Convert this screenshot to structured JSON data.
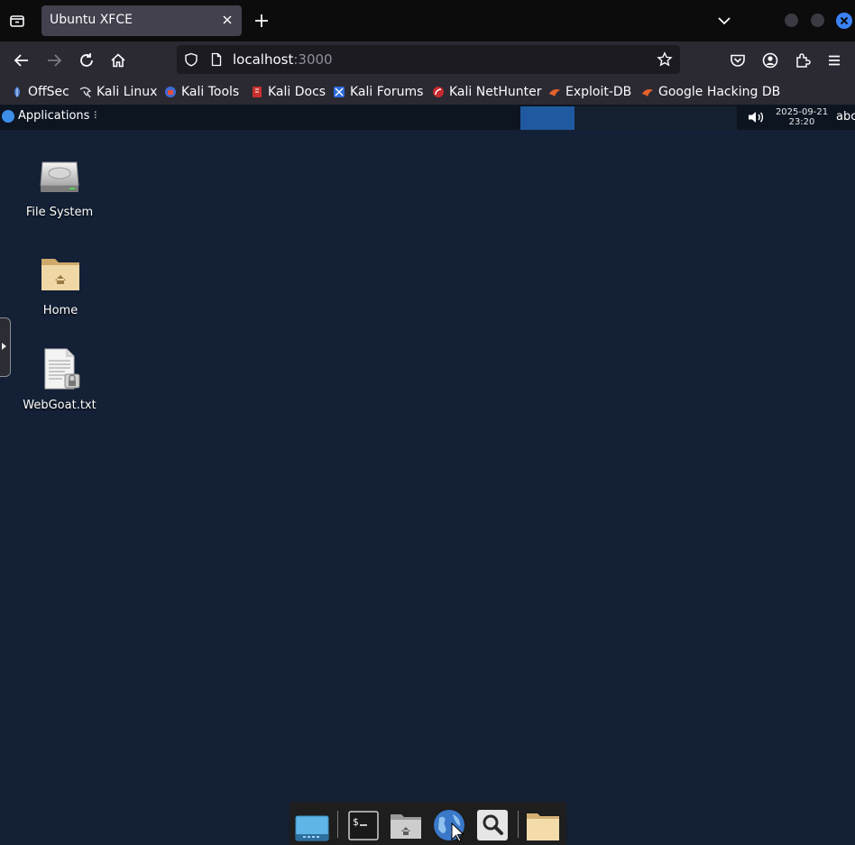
{
  "browser": {
    "tab": {
      "title": "Ubuntu XFCE"
    },
    "url": {
      "host": "localhost",
      "port": ":3000"
    },
    "bookmarks": [
      {
        "label": "OffSec",
        "icon": "offsec-icon"
      },
      {
        "label": "Kali Linux",
        "icon": "kali-dragon-icon"
      },
      {
        "label": "Kali Tools",
        "icon": "kali-tools-icon"
      },
      {
        "label": "Kali Docs",
        "icon": "kali-docs-icon"
      },
      {
        "label": "Kali Forums",
        "icon": "kali-forums-icon"
      },
      {
        "label": "Kali NetHunter",
        "icon": "nethunter-icon"
      },
      {
        "label": "Exploit-DB",
        "icon": "exploit-db-icon"
      },
      {
        "label": "Google Hacking DB",
        "icon": "ghdb-icon"
      }
    ]
  },
  "desktop": {
    "panel": {
      "applications_label": "Applications",
      "menu_glyph": "⠇",
      "clock_date": "2025-09-21",
      "clock_time": "23:20",
      "keyboard_layout": "abc"
    },
    "icons": [
      {
        "label": "File System",
        "icon": "drive-icon"
      },
      {
        "label": "Home",
        "icon": "home-folder-icon"
      },
      {
        "label": "WebGoat.txt",
        "icon": "text-file-locked-icon"
      }
    ],
    "dock": [
      "show-desktop-icon",
      "terminal-icon",
      "home-folder-icon",
      "web-browser-icon",
      "search-icon",
      "folder-icon"
    ]
  },
  "colors": {
    "desktop_bg": "#132035",
    "panel_bg": "#0d1521",
    "active_workspace": "#1f5aa0",
    "browser_toolbar": "#2b2a33",
    "close_button": "#3b82f6"
  }
}
